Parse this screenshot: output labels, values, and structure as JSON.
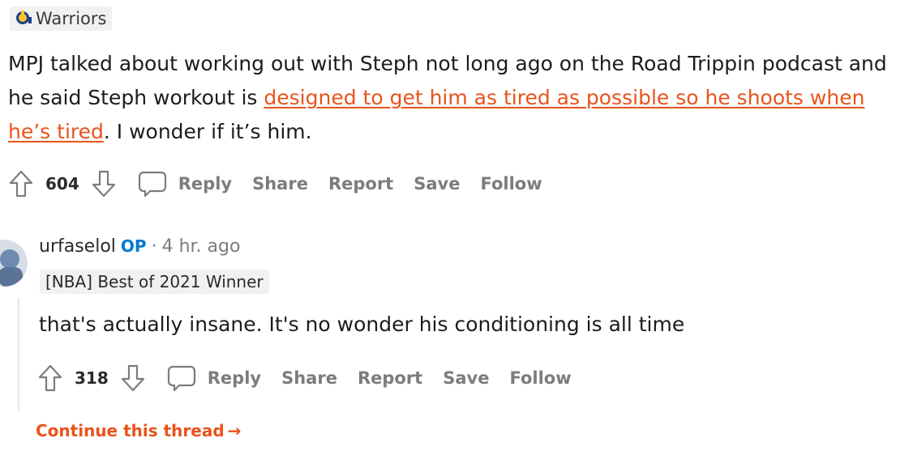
{
  "parent_comment": {
    "flair": {
      "icon": "warriors-logo-icon",
      "text": "Warriors"
    },
    "body": {
      "text_before": "MPJ talked about working out with Steph not long ago on the Road Trippin podcast and he said Steph workout is ",
      "link_text": "designed to get him as tired as possible so he shoots when he’s tired",
      "text_after": ". I wonder if it’s him."
    },
    "score": "604",
    "actions": {
      "reply": "Reply",
      "share": "Share",
      "report": "Report",
      "save": "Save",
      "follow": "Follow"
    }
  },
  "reply_comment": {
    "username": "urfaselol",
    "op_label": "OP",
    "separator": "·",
    "time": "4 hr. ago",
    "flair": "[NBA] Best of 2021 Winner",
    "body": "that's actually insane. It's no wonder his conditioning is all time",
    "score": "318",
    "actions": {
      "reply": "Reply",
      "share": "Share",
      "report": "Report",
      "save": "Save",
      "follow": "Follow"
    }
  },
  "continue_thread": {
    "label": "Continue this thread",
    "arrow": "→"
  },
  "colors": {
    "link": "#e8541c",
    "op": "#0079d3",
    "meta": "#7c7c7c",
    "flair_bg": "#f0f1f2"
  }
}
